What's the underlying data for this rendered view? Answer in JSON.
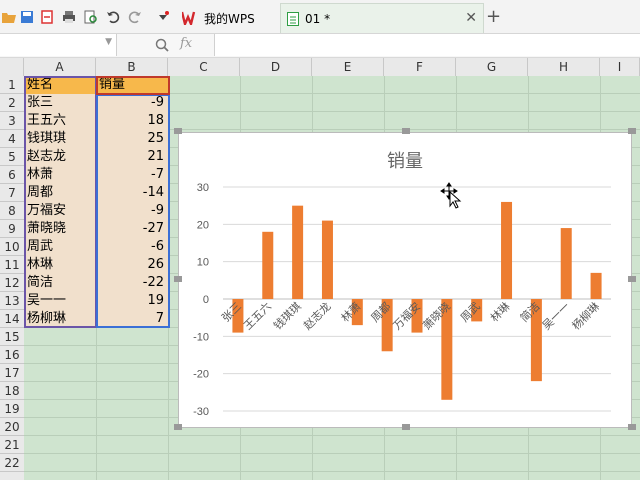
{
  "toolbar": {
    "icons": [
      "folder-open-icon",
      "save-icon",
      "export-pdf-icon",
      "print-icon",
      "print-preview-icon",
      "undo-icon",
      "redo-icon",
      "more-icon"
    ]
  },
  "tabs": [
    {
      "label": "我的WPS",
      "active": false
    },
    {
      "label": "01 *",
      "active": true
    }
  ],
  "formula_bar": {
    "name_box": "",
    "fx": "fx",
    "formula": ""
  },
  "columns": [
    "A",
    "B",
    "C",
    "D",
    "E",
    "F",
    "G",
    "H",
    "I"
  ],
  "rows": [
    "1",
    "2",
    "3",
    "4",
    "5",
    "6",
    "7",
    "8",
    "9",
    "10",
    "11",
    "12",
    "13",
    "14",
    "15",
    "16",
    "17",
    "18",
    "19",
    "20",
    "21",
    "22"
  ],
  "sheet": {
    "header": [
      "姓名",
      "销量"
    ],
    "data": [
      [
        "张三",
        "-9"
      ],
      [
        "王五六",
        "18"
      ],
      [
        "钱琪琪",
        "25"
      ],
      [
        "赵志龙",
        "21"
      ],
      [
        "林萧",
        "-7"
      ],
      [
        "周都",
        "-14"
      ],
      [
        "万福安",
        "-9"
      ],
      [
        "萧晓晓",
        "-27"
      ],
      [
        "周武",
        "-6"
      ],
      [
        "林琳",
        "26"
      ],
      [
        "简洁",
        "-22"
      ],
      [
        "吴一一",
        "19"
      ],
      [
        "杨柳琳",
        "7"
      ]
    ]
  },
  "colors": {
    "bar": "#ed7d31",
    "header_fill": "#f7b84b",
    "selection": "#6b55a8"
  },
  "chart_data": {
    "type": "bar",
    "title": "销量",
    "categories": [
      "张三",
      "王五六",
      "钱琪琪",
      "赵志龙",
      "林萧",
      "周都",
      "万福安",
      "萧晓晓",
      "周武",
      "林琳",
      "简洁",
      "吴一一",
      "杨柳琳"
    ],
    "values": [
      -9,
      18,
      25,
      21,
      -7,
      -14,
      -9,
      -27,
      -6,
      26,
      -22,
      19,
      7
    ],
    "ylim": [
      -30,
      30
    ],
    "yticks": [
      "30",
      "20",
      "10",
      "0",
      "-10",
      "-20",
      "-30"
    ],
    "grid": true,
    "legend": "none"
  }
}
